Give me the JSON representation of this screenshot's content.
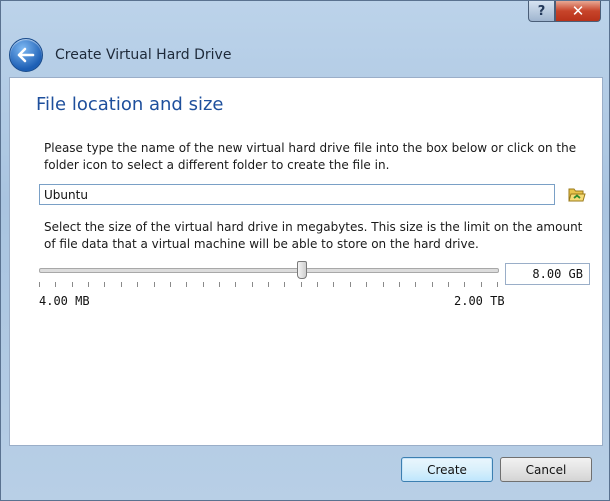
{
  "titlebar": {
    "help_label": "?",
    "close_label": "✕"
  },
  "header": {
    "title": "Create Virtual Hard Drive"
  },
  "page": {
    "title": "File location and size",
    "location_description": "Please type the name of the new virtual hard drive file into the box below or click on the folder icon to select a different folder to create the file in.",
    "file_name": "Ubuntu",
    "size_description": "Select the size of the virtual hard drive in megabytes. This size is the limit on the amount of file data that a virtual machine will be able to store on the hard drive.",
    "size_value": "8.00 GB",
    "size_min_label": "4.00 MB",
    "size_max_label": "2.00 TB",
    "slider_fraction": 0.575
  },
  "buttons": {
    "create_label": "Create",
    "cancel_label": "Cancel"
  },
  "colors": {
    "accent": "#1e4f9c",
    "close": "#c7442a"
  },
  "icons": {
    "back": "back-arrow-icon",
    "folder": "folder-icon"
  }
}
